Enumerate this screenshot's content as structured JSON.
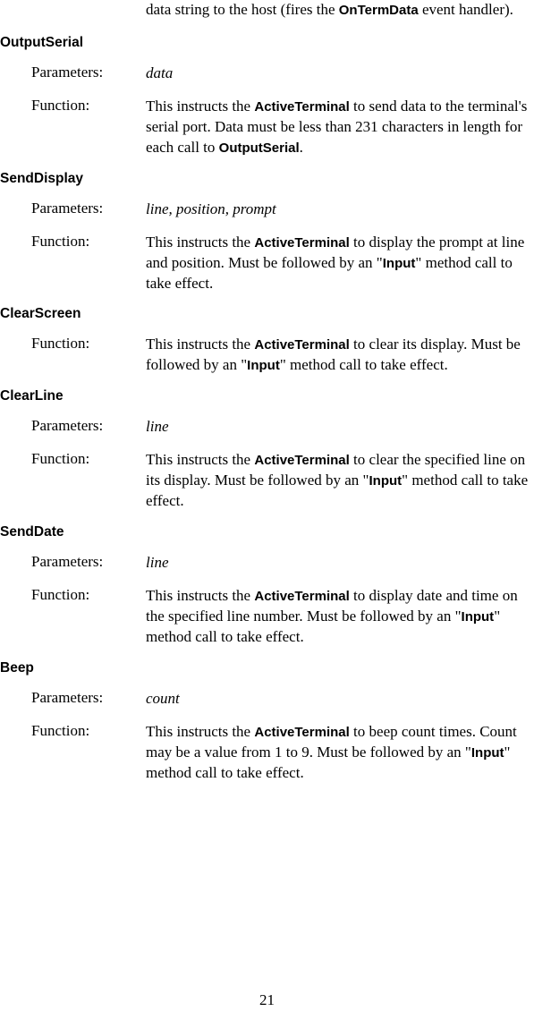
{
  "intro_fragment": {
    "pre": "data string to the host (fires the ",
    "bold1": "OnTermData",
    "post": " event handler)."
  },
  "labels": {
    "parameters": "Parameters:",
    "function": "Function:"
  },
  "methods": {
    "output_serial": {
      "name": "OutputSerial",
      "params": "data",
      "func": {
        "t1": "This instructs the ",
        "b1": "ActiveTerminal",
        "t2": " to send data to the terminal's serial port. Data must be less than 231 characters in length for each call to ",
        "b2": "OutputSerial",
        "t3": "."
      }
    },
    "send_display": {
      "name": "SendDisplay",
      "params": "line, position, prompt",
      "func": {
        "t1": "This instructs the ",
        "b1": "ActiveTerminal",
        "t2": " to display the prompt at line and position. Must be followed by an \"",
        "b2": "Input",
        "t3": "\" method call to take effect."
      }
    },
    "clear_screen": {
      "name": "ClearScreen",
      "func": {
        "t1": "This instructs the ",
        "b1": "ActiveTerminal",
        "t2": " to clear its display. Must be followed by an \"",
        "b2": "Input",
        "t3": "\" method call to take effect."
      }
    },
    "clear_line": {
      "name": "ClearLine",
      "params": "line",
      "func": {
        "t1": "This instructs the ",
        "b1": "ActiveTerminal",
        "t2": " to clear the specified line on its display. Must be followed by an \"",
        "b2": "Input",
        "t3": "\" method call to take effect."
      }
    },
    "send_date": {
      "name": "SendDate",
      "params": "line",
      "func": {
        "t1": "This instructs the ",
        "b1": "ActiveTerminal",
        "t2": " to display date and time on the specified line number. Must be followed by an \"",
        "b2": "Input",
        "t3": "\" method call to take effect."
      }
    },
    "beep": {
      "name": "Beep",
      "params": "count",
      "func": {
        "t1": "This instructs the ",
        "b1": "ActiveTerminal",
        "t2": " to beep count times. Count may be a value from 1 to 9. Must be followed by an \"",
        "b2": "Input",
        "t3": "\" method call to take effect."
      }
    }
  },
  "page_number": "21"
}
